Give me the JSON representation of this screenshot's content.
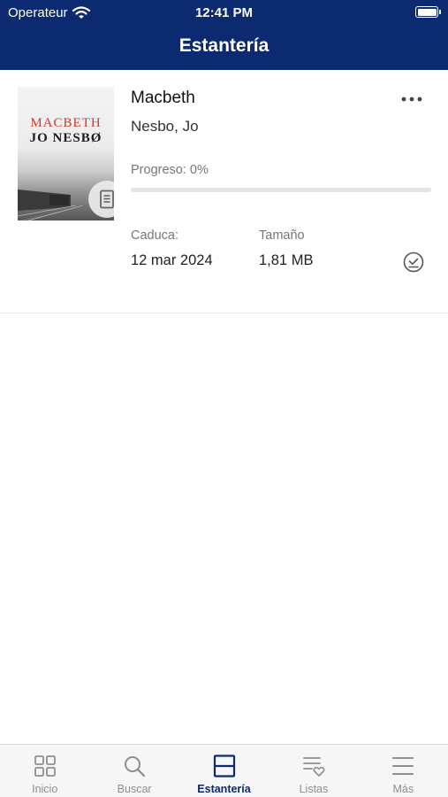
{
  "status_bar": {
    "carrier": "Operateur",
    "time": "12:41 PM"
  },
  "header": {
    "title": "Estantería"
  },
  "book": {
    "cover_title": "MACBETH",
    "cover_author": "JO NESBØ",
    "title": "Macbeth",
    "author": "Nesbo, Jo",
    "progress_label": "Progreso: 0%",
    "progress_value": 0,
    "expires_label": "Caduca:",
    "expires_value": "12 mar 2024",
    "size_label": "Tamaño",
    "size_value": "1,81 MB"
  },
  "tabs": [
    {
      "label": "Inicio",
      "icon": "grid-icon"
    },
    {
      "label": "Buscar",
      "icon": "search-icon"
    },
    {
      "label": "Estantería",
      "icon": "shelf-icon",
      "active": true
    },
    {
      "label": "Listas",
      "icon": "list-heart-icon"
    },
    {
      "label": "Más",
      "icon": "menu-icon"
    }
  ],
  "colors": {
    "brand": "#0b2a6f",
    "inactive": "#8e8e8e",
    "cover_title": "#cc3b2f"
  }
}
